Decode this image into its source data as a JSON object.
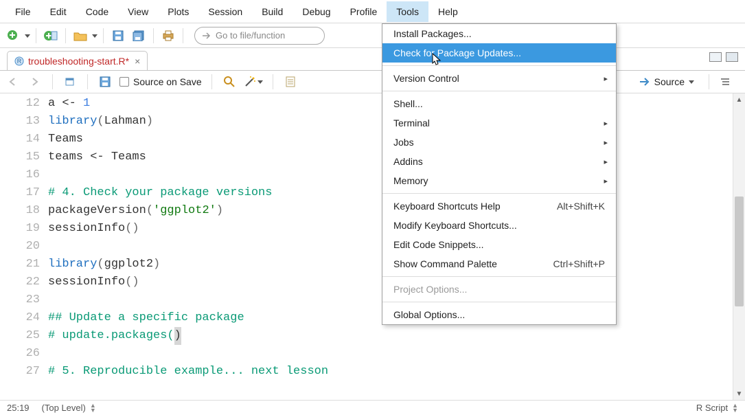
{
  "menubar": [
    "File",
    "Edit",
    "Code",
    "View",
    "Plots",
    "Session",
    "Build",
    "Debug",
    "Profile",
    "Tools",
    "Help"
  ],
  "menubar_open_index": 9,
  "maintoolbar": {
    "goto_placeholder": "Go to file/function"
  },
  "tab": {
    "filename": "troubleshooting-start.R*"
  },
  "src_toolbar": {
    "source_on_save": "Source on Save",
    "source_btn": "Source"
  },
  "editor": {
    "first_line_no": 12,
    "lines": [
      [
        [
          "default",
          "a <- "
        ],
        [
          "num",
          "1"
        ]
      ],
      [
        [
          "key",
          "library"
        ],
        [
          "paren",
          "("
        ],
        [
          "default",
          "Lahman"
        ],
        [
          "paren",
          ")"
        ]
      ],
      [
        [
          "default",
          "Teams"
        ]
      ],
      [
        [
          "default",
          "teams <- Teams"
        ]
      ],
      [],
      [
        [
          "comment",
          "# 4. Check your package versions"
        ]
      ],
      [
        [
          "default",
          "packageVersion"
        ],
        [
          "paren",
          "("
        ],
        [
          "str",
          "'ggplot2'"
        ],
        [
          "paren",
          ")"
        ]
      ],
      [
        [
          "default",
          "sessionInfo"
        ],
        [
          "paren",
          "()"
        ]
      ],
      [],
      [
        [
          "key",
          "library"
        ],
        [
          "paren",
          "("
        ],
        [
          "default",
          "ggplot2"
        ],
        [
          "paren",
          ")"
        ]
      ],
      [
        [
          "default",
          "sessionInfo"
        ],
        [
          "paren",
          "()"
        ]
      ],
      [],
      [
        [
          "comment",
          "## Update a specific package"
        ]
      ],
      [
        [
          "comment",
          "# update.packages("
        ],
        [
          "cursor",
          ")"
        ]
      ],
      [],
      [
        [
          "comment",
          "# 5. Reproducible example... next lesson"
        ]
      ]
    ]
  },
  "statusbar": {
    "pos": "25:19",
    "scope": "(Top Level)",
    "mode": "R Script"
  },
  "tools_menu": [
    {
      "type": "item",
      "label": "Install Packages..."
    },
    {
      "type": "item",
      "label": "Check for Package Updates...",
      "highlight": true,
      "cursor": true
    },
    {
      "type": "sep"
    },
    {
      "type": "sub",
      "label": "Version Control"
    },
    {
      "type": "sep"
    },
    {
      "type": "item",
      "label": "Shell..."
    },
    {
      "type": "sub",
      "label": "Terminal"
    },
    {
      "type": "sub",
      "label": "Jobs"
    },
    {
      "type": "sub",
      "label": "Addins"
    },
    {
      "type": "sub",
      "label": "Memory"
    },
    {
      "type": "sep"
    },
    {
      "type": "item",
      "label": "Keyboard Shortcuts Help",
      "shortcut": "Alt+Shift+K"
    },
    {
      "type": "item",
      "label": "Modify Keyboard Shortcuts..."
    },
    {
      "type": "item",
      "label": "Edit Code Snippets..."
    },
    {
      "type": "item",
      "label": "Show Command Palette",
      "shortcut": "Ctrl+Shift+P"
    },
    {
      "type": "sep"
    },
    {
      "type": "item",
      "label": "Project Options...",
      "disabled": true
    },
    {
      "type": "sep"
    },
    {
      "type": "item",
      "label": "Global Options..."
    }
  ]
}
